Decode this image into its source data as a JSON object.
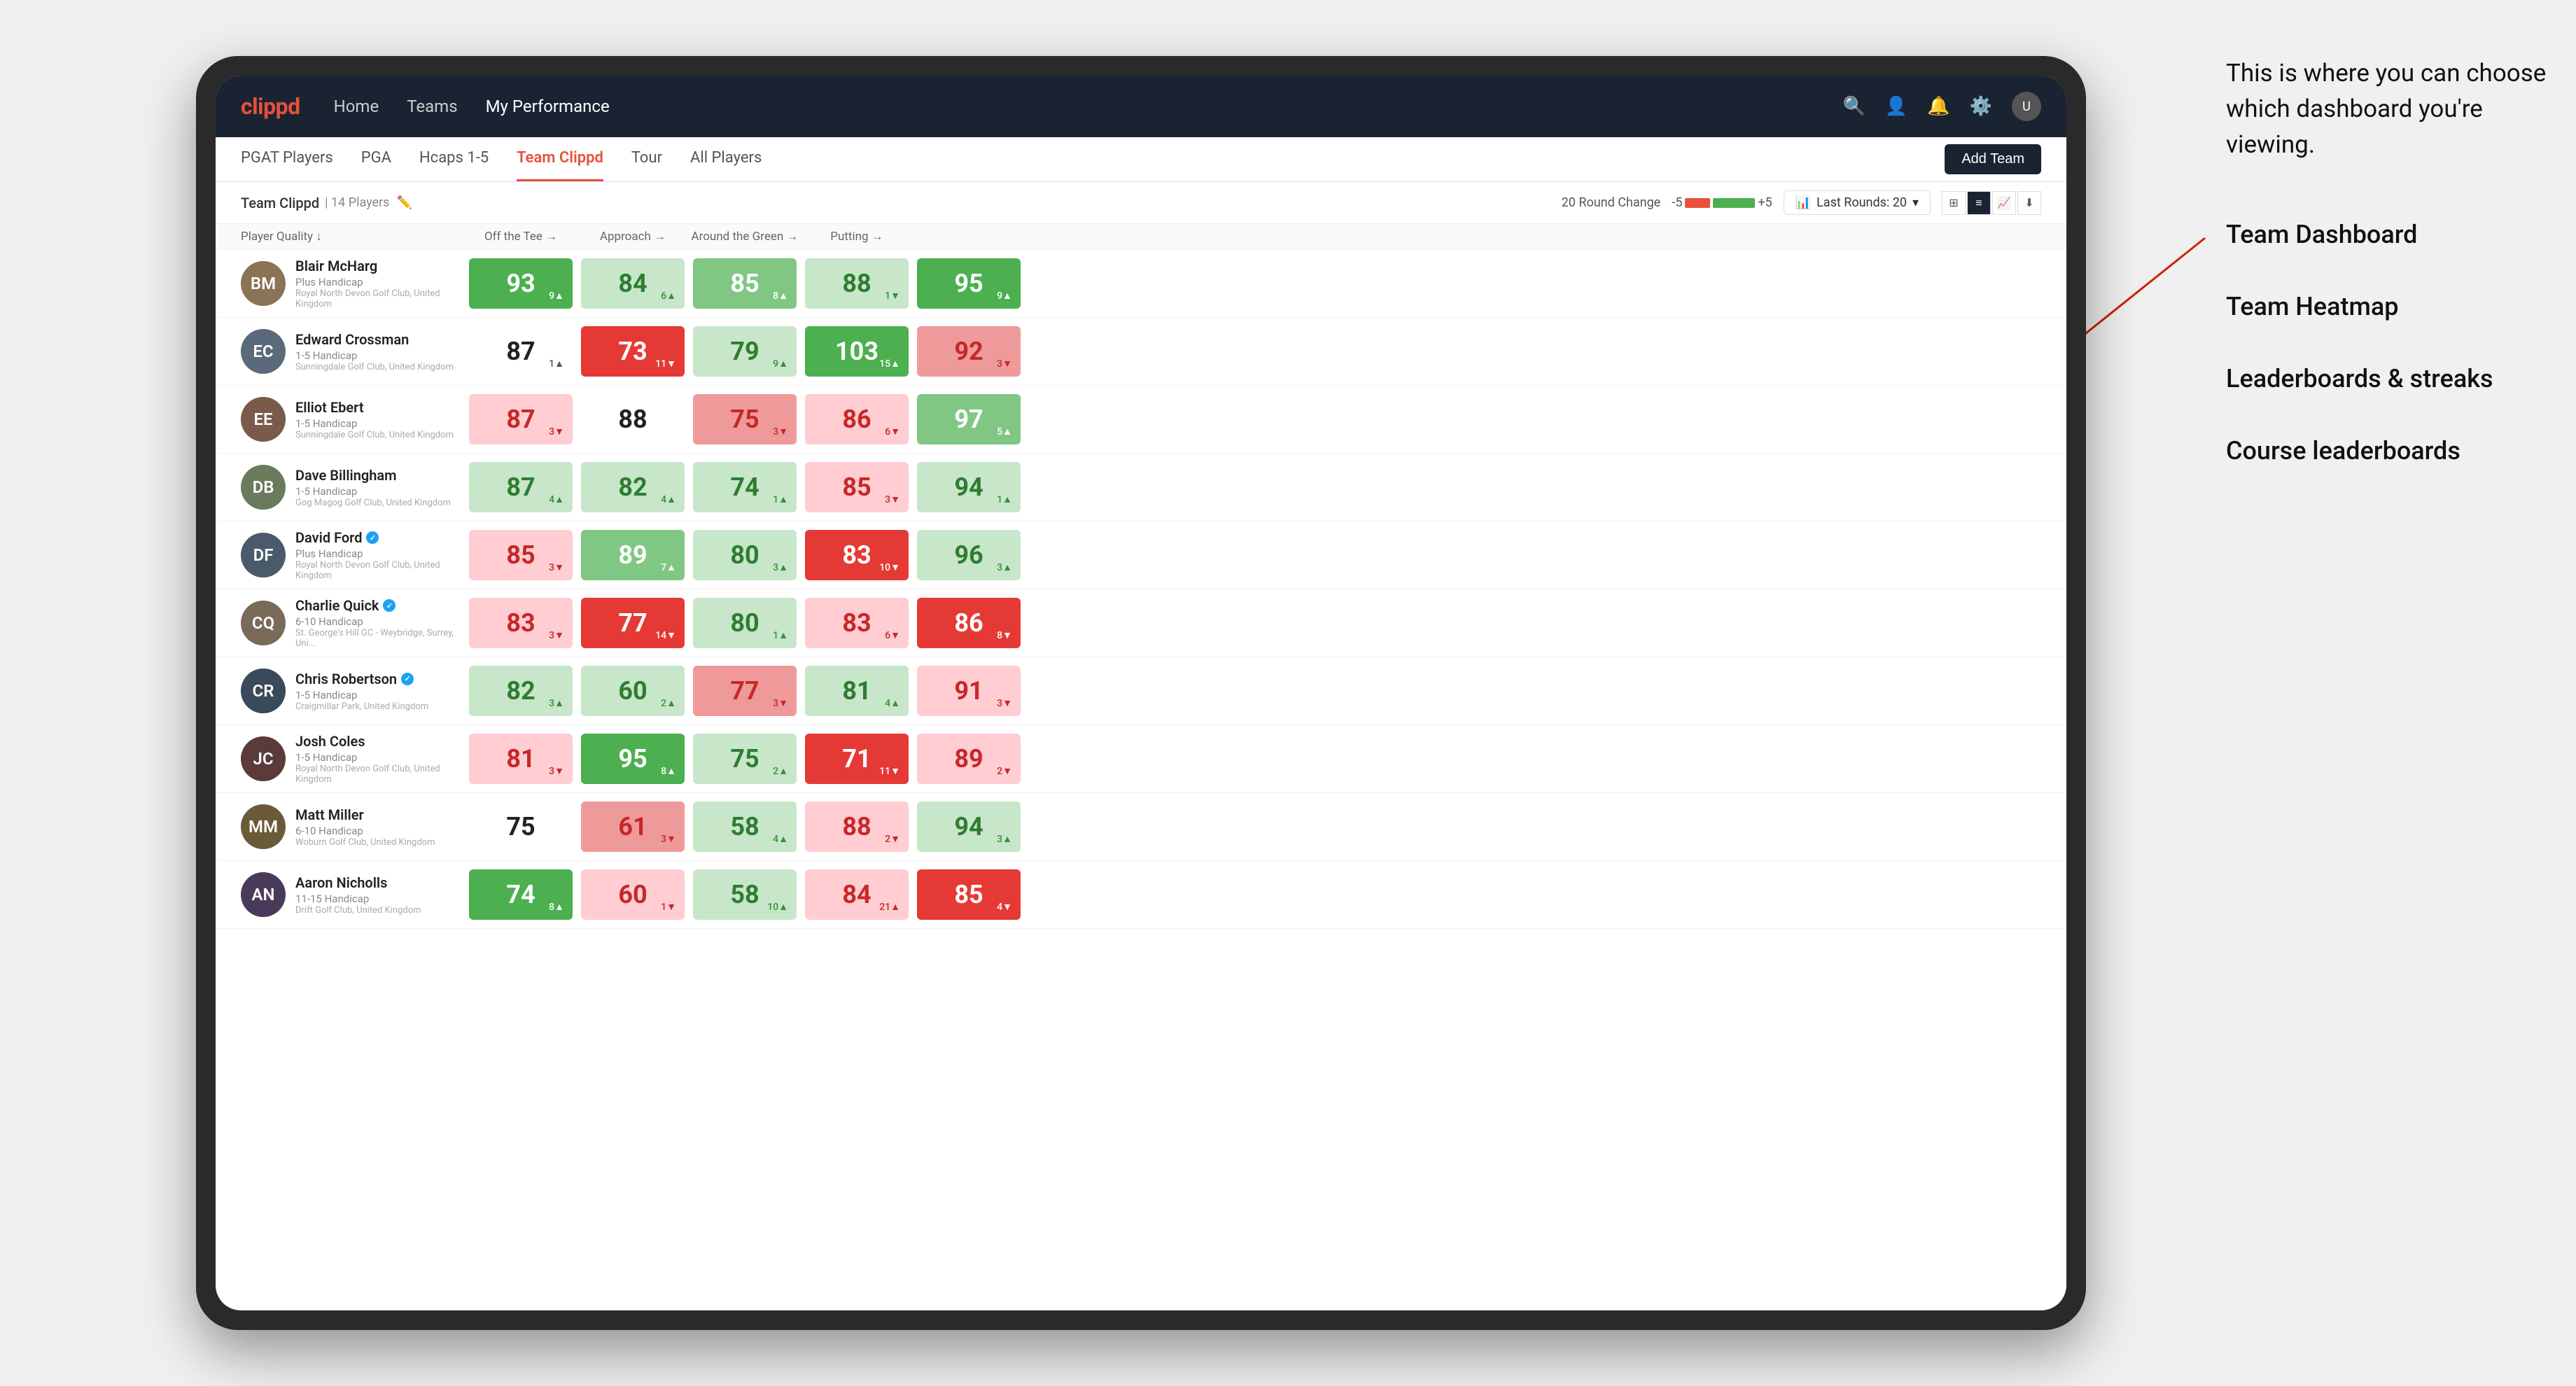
{
  "annotation": {
    "callout": "This is where you can choose which dashboard you're viewing.",
    "options": [
      "Team Dashboard",
      "Team Heatmap",
      "Leaderboards & streaks",
      "Course leaderboards"
    ]
  },
  "navbar": {
    "logo": "clippd",
    "links": [
      "Home",
      "Teams",
      "My Performance"
    ],
    "active_link": "My Performance"
  },
  "subtabs": {
    "tabs": [
      "PGAT Players",
      "PGA",
      "Hcaps 1-5",
      "Team Clippd",
      "Tour",
      "All Players"
    ],
    "active": "Team Clippd",
    "add_team_label": "Add Team"
  },
  "team_row": {
    "name": "Team Clippd",
    "count": "14 Players",
    "round_change_label": "20 Round Change",
    "neg": "-5",
    "pos": "+5",
    "last_rounds_label": "Last Rounds:",
    "last_rounds_value": "20"
  },
  "table": {
    "headers": [
      "Player Quality ↓",
      "Off the Tee →",
      "Approach →",
      "Around the Green →",
      "Putting →"
    ],
    "players": [
      {
        "name": "Blair McHarg",
        "handicap": "Plus Handicap",
        "club": "Royal North Devon Golf Club, United Kingdom",
        "avatar_color": "#8B7355",
        "scores": [
          {
            "value": "93",
            "change": "9",
            "dir": "up",
            "bg": "bg-green-dark"
          },
          {
            "value": "84",
            "change": "6",
            "dir": "up",
            "bg": "bg-green-light"
          },
          {
            "value": "85",
            "change": "8",
            "dir": "up",
            "bg": "bg-green-mid"
          },
          {
            "value": "88",
            "change": "1",
            "dir": "down",
            "bg": "bg-green-light"
          },
          {
            "value": "95",
            "change": "9",
            "dir": "up",
            "bg": "bg-green-dark"
          }
        ]
      },
      {
        "name": "Edward Crossman",
        "handicap": "1-5 Handicap",
        "club": "Sunningdale Golf Club, United Kingdom",
        "avatar_color": "#5a6a7a",
        "scores": [
          {
            "value": "87",
            "change": "1",
            "dir": "up",
            "bg": "bg-white"
          },
          {
            "value": "73",
            "change": "11",
            "dir": "down",
            "bg": "bg-red-dark"
          },
          {
            "value": "79",
            "change": "9",
            "dir": "up",
            "bg": "bg-green-light"
          },
          {
            "value": "103",
            "change": "15",
            "dir": "up",
            "bg": "bg-green-dark"
          },
          {
            "value": "92",
            "change": "3",
            "dir": "down",
            "bg": "bg-red-mid"
          }
        ]
      },
      {
        "name": "Elliot Ebert",
        "handicap": "1-5 Handicap",
        "club": "Sunningdale Golf Club, United Kingdom",
        "avatar_color": "#7a5a4a",
        "scores": [
          {
            "value": "87",
            "change": "3",
            "dir": "down",
            "bg": "bg-red-light"
          },
          {
            "value": "88",
            "change": "",
            "dir": "",
            "bg": "bg-white"
          },
          {
            "value": "75",
            "change": "3",
            "dir": "down",
            "bg": "bg-red-mid"
          },
          {
            "value": "86",
            "change": "6",
            "dir": "down",
            "bg": "bg-red-light"
          },
          {
            "value": "97",
            "change": "5",
            "dir": "up",
            "bg": "bg-green-mid"
          }
        ]
      },
      {
        "name": "Dave Billingham",
        "handicap": "1-5 Handicap",
        "club": "Gog Magog Golf Club, United Kingdom",
        "avatar_color": "#6a7a5a",
        "scores": [
          {
            "value": "87",
            "change": "4",
            "dir": "up",
            "bg": "bg-green-light"
          },
          {
            "value": "82",
            "change": "4",
            "dir": "up",
            "bg": "bg-green-light"
          },
          {
            "value": "74",
            "change": "1",
            "dir": "up",
            "bg": "bg-green-light"
          },
          {
            "value": "85",
            "change": "3",
            "dir": "down",
            "bg": "bg-red-light"
          },
          {
            "value": "94",
            "change": "1",
            "dir": "up",
            "bg": "bg-green-light"
          }
        ]
      },
      {
        "name": "David Ford",
        "handicap": "Plus Handicap",
        "club": "Royal North Devon Golf Club, United Kingdom",
        "avatar_color": "#4a5a6a",
        "verified": true,
        "scores": [
          {
            "value": "85",
            "change": "3",
            "dir": "down",
            "bg": "bg-red-light"
          },
          {
            "value": "89",
            "change": "7",
            "dir": "up",
            "bg": "bg-green-mid"
          },
          {
            "value": "80",
            "change": "3",
            "dir": "up",
            "bg": "bg-green-light"
          },
          {
            "value": "83",
            "change": "10",
            "dir": "down",
            "bg": "bg-red-dark"
          },
          {
            "value": "96",
            "change": "3",
            "dir": "up",
            "bg": "bg-green-light"
          }
        ]
      },
      {
        "name": "Charlie Quick",
        "handicap": "6-10 Handicap",
        "club": "St. George's Hill GC - Weybridge, Surrey, Uni...",
        "avatar_color": "#7a6a5a",
        "verified": true,
        "scores": [
          {
            "value": "83",
            "change": "3",
            "dir": "down",
            "bg": "bg-red-light"
          },
          {
            "value": "77",
            "change": "14",
            "dir": "down",
            "bg": "bg-red-dark"
          },
          {
            "value": "80",
            "change": "1",
            "dir": "up",
            "bg": "bg-green-light"
          },
          {
            "value": "83",
            "change": "6",
            "dir": "down",
            "bg": "bg-red-light"
          },
          {
            "value": "86",
            "change": "8",
            "dir": "down",
            "bg": "bg-red-dark"
          }
        ]
      },
      {
        "name": "Chris Robertson",
        "handicap": "1-5 Handicap",
        "club": "Craigmillar Park, United Kingdom",
        "avatar_color": "#3a4a5a",
        "verified": true,
        "scores": [
          {
            "value": "82",
            "change": "3",
            "dir": "up",
            "bg": "bg-green-light"
          },
          {
            "value": "60",
            "change": "2",
            "dir": "up",
            "bg": "bg-green-light"
          },
          {
            "value": "77",
            "change": "3",
            "dir": "down",
            "bg": "bg-red-mid"
          },
          {
            "value": "81",
            "change": "4",
            "dir": "up",
            "bg": "bg-green-light"
          },
          {
            "value": "91",
            "change": "3",
            "dir": "down",
            "bg": "bg-red-light"
          }
        ]
      },
      {
        "name": "Josh Coles",
        "handicap": "1-5 Handicap",
        "club": "Royal North Devon Golf Club, United Kingdom",
        "avatar_color": "#5a3a3a",
        "scores": [
          {
            "value": "81",
            "change": "3",
            "dir": "down",
            "bg": "bg-red-light"
          },
          {
            "value": "95",
            "change": "8",
            "dir": "up",
            "bg": "bg-green-dark"
          },
          {
            "value": "75",
            "change": "2",
            "dir": "up",
            "bg": "bg-green-light"
          },
          {
            "value": "71",
            "change": "11",
            "dir": "down",
            "bg": "bg-red-dark"
          },
          {
            "value": "89",
            "change": "2",
            "dir": "down",
            "bg": "bg-red-light"
          }
        ]
      },
      {
        "name": "Matt Miller",
        "handicap": "6-10 Handicap",
        "club": "Woburn Golf Club, United Kingdom",
        "avatar_color": "#6a5a3a",
        "scores": [
          {
            "value": "75",
            "change": "",
            "dir": "",
            "bg": "bg-white"
          },
          {
            "value": "61",
            "change": "3",
            "dir": "down",
            "bg": "bg-red-mid"
          },
          {
            "value": "58",
            "change": "4",
            "dir": "up",
            "bg": "bg-green-light"
          },
          {
            "value": "88",
            "change": "2",
            "dir": "down",
            "bg": "bg-red-light"
          },
          {
            "value": "94",
            "change": "3",
            "dir": "up",
            "bg": "bg-green-light"
          }
        ]
      },
      {
        "name": "Aaron Nicholls",
        "handicap": "11-15 Handicap",
        "club": "Drift Golf Club, United Kingdom",
        "avatar_color": "#4a3a5a",
        "scores": [
          {
            "value": "74",
            "change": "8",
            "dir": "up",
            "bg": "bg-green-dark"
          },
          {
            "value": "60",
            "change": "1",
            "dir": "down",
            "bg": "bg-red-light"
          },
          {
            "value": "58",
            "change": "10",
            "dir": "up",
            "bg": "bg-green-light"
          },
          {
            "value": "84",
            "change": "21",
            "dir": "up",
            "bg": "bg-red-light"
          },
          {
            "value": "85",
            "change": "4",
            "dir": "down",
            "bg": "bg-red-dark"
          }
        ]
      }
    ]
  }
}
